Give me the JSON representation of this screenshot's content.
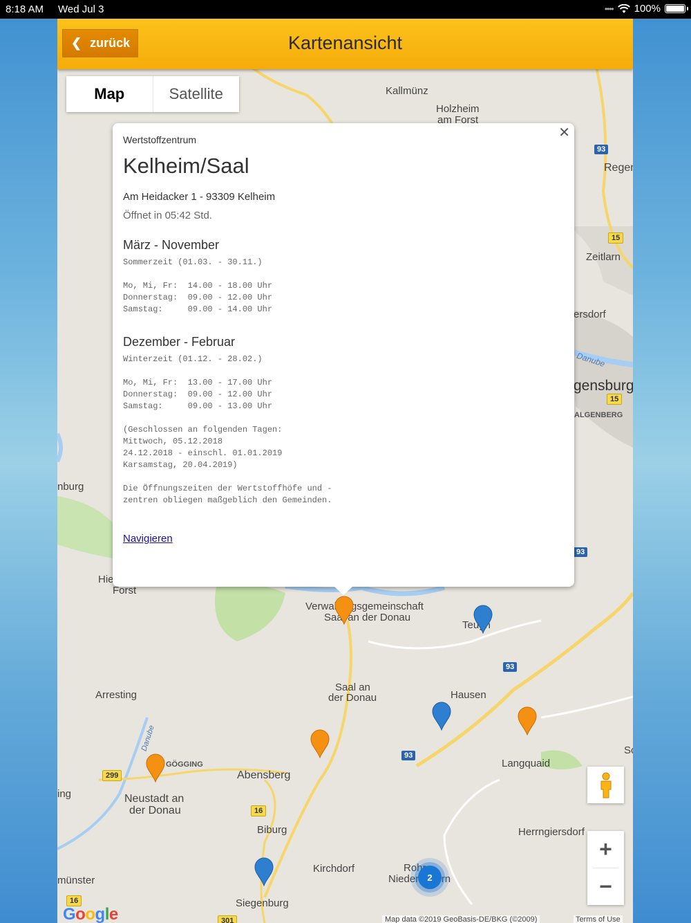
{
  "status_bar": {
    "time": "8:18 AM",
    "date": "Wed Jul 3",
    "battery": "100%"
  },
  "header": {
    "back_label": "zurück",
    "title": "Kartenansicht"
  },
  "map_type": {
    "map": "Map",
    "satellite": "Satellite"
  },
  "popup": {
    "subtitle": "Wertstoffzentrum",
    "title": "Kelheim/Saal",
    "address": "Am Heidacker 1 - 93309 Kelheim",
    "opens": "Öffnet in 05:42 Std.",
    "season1_title": "März - November",
    "season1_text": "Sommerzeit (01.03. - 30.11.)\n\nMo, Mi, Fr:  14.00 - 18.00 Uhr\nDonnerstag:  09.00 - 12.00 Uhr\nSamstag:     09.00 - 14.00 Uhr",
    "season2_title": "Dezember - Februar",
    "season2_text": "Winterzeit (01.12. - 28.02.)\n\nMo, Mi, Fr:  13.00 - 17.00 Uhr\nDonnerstag:  09.00 - 12.00 Uhr\nSamstag:     09.00 - 13.00 Uhr\n\n(Geschlossen an folgenden Tagen:\nMittwoch, 05.12.2018\n24.12.2018 - einschl. 01.01.2019\nKarsamstag, 20.04.2019)\n\nDie Öffnungszeiten der Wertstoffhöfe und -\nzentren obliegen maßgeblich den Gemeinden.",
    "navigate_label": "Navigieren",
    "close_symbol": "✕"
  },
  "map_labels": {
    "kallmuenz": "Kallmünz",
    "holzheim": "Holzheim",
    "am_forst": "am Forst",
    "regen": "Regen",
    "zeitlarn": "Zeitlarn",
    "ersdorf": "ersdorf",
    "danube_east": "Danube",
    "gensburg": "gensburg",
    "algenberg": "ALGENBERG",
    "nburg": "nburg",
    "hie": "Hie",
    "forst": "Forst",
    "verwaltung_1": "Verwaltungsgemeinschaft",
    "verwaltung_2": "Saal an der Donau",
    "teugn": "Teugn",
    "saal_1": "Saal an",
    "saal_2": "der Donau",
    "hausen": "Hausen",
    "arresting": "Arresting",
    "danube_west": "Danube",
    "goegging": "GÖGGING",
    "abensberg": "Abensberg",
    "langquaid": "Langquaid",
    "sc": "Sc",
    "ing": "ing",
    "neustadt_1": "Neustadt an",
    "neustadt_2": "der Donau",
    "biburg": "Biburg",
    "herrngiersdorf": "Herrngiersdorf",
    "kirchdorf": "Kirchdorf",
    "rohr_1": "Rohr",
    "rohr_2": "Niederbayern",
    "muenster": "münster",
    "siegenburg": "Siegenburg"
  },
  "road_shields": {
    "r93a": "93",
    "r15a": "15",
    "r15b": "15",
    "r93b": "93",
    "r93c": "93",
    "r93d": "93",
    "r299": "299",
    "r16a": "16",
    "r16b": "16",
    "r301": "301"
  },
  "cluster_count": "2",
  "google_logo": "Google",
  "attribution": "Map data ©2019 GeoBasis-DE/BKG (©2009)",
  "terms": "Terms of Use",
  "colors": {
    "header": "#f5ac0b",
    "back_button": "#d47a00",
    "marker_orange": "#f49012",
    "marker_blue": "#2f7fd1",
    "link": "#1a0dab"
  }
}
